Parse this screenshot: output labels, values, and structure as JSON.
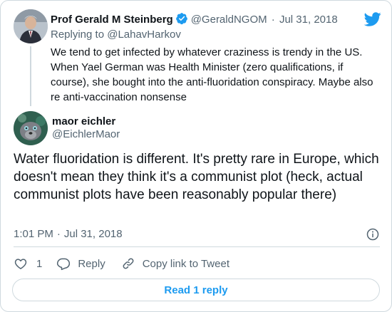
{
  "parent_tweet": {
    "author_name": "Prof Gerald M Steinberg",
    "handle": "@GeraldNGOM",
    "separator": "·",
    "date": "Jul 31, 2018",
    "replying_to": "Replying to @LahavHarkov",
    "text": "We tend to get infected by whatever craziness is trendy in the US. When Yael German was Health Minister (zero qualifications, if course), she bought into the anti-fluoridation conspiracy. Maybe also re anti-vaccination nonsense"
  },
  "main_tweet": {
    "author_name": "maor eichler",
    "handle": "@EichlerMaor",
    "text": "Water fluoridation is different. It's pretty rare in Europe, which doesn't mean they think it's a communist plot (heck, actual communist plots have been reasonably popular there)",
    "time": "1:01 PM",
    "separator": "·",
    "date": "Jul 31, 2018"
  },
  "actions": {
    "like_count": "1",
    "reply_label": "Reply",
    "copy_link_label": "Copy link to Tweet"
  },
  "read_replies_label": "Read 1 reply",
  "icons": {
    "brand": "twitter-bird-icon",
    "verified": "verified-badge-icon",
    "info": "info-icon",
    "like": "heart-icon",
    "reply": "speech-bubble-icon",
    "copy_link": "link-icon"
  },
  "colors": {
    "brand_blue": "#1d9bf0",
    "text_primary": "#0f1419",
    "text_secondary": "#536471",
    "border": "#cfd9de"
  }
}
